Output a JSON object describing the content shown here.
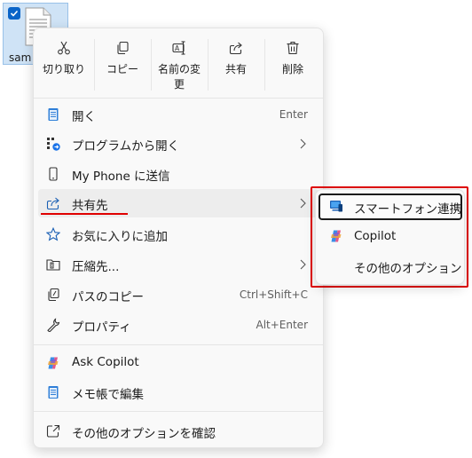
{
  "desktop_file": {
    "name": "sam"
  },
  "toolbar": {
    "cut": "切り取り",
    "copy": "コピー",
    "rename": "名前の変更",
    "share": "共有",
    "delete": "削除"
  },
  "menu": {
    "open": {
      "label": "開く",
      "shortcut": "Enter"
    },
    "open_with": {
      "label": "プログラムから開く"
    },
    "send_to_phone": {
      "label": "My Phone に送信"
    },
    "share_to": {
      "label": "共有先"
    },
    "add_favorite": {
      "label": "お気に入りに追加"
    },
    "compress": {
      "label": "圧縮先..."
    },
    "copy_path": {
      "label": "パスのコピー",
      "shortcut": "Ctrl+Shift+C"
    },
    "properties": {
      "label": "プロパティ",
      "shortcut": "Alt+Enter"
    },
    "ask_copilot": {
      "label": "Ask Copilot"
    },
    "edit_notepad": {
      "label": "メモ帳で編集"
    },
    "more_options": {
      "label": "その他のオプションを確認"
    }
  },
  "submenu": {
    "phone_link": "スマートフォン連携",
    "copilot": "Copilot",
    "other_options": "その他のオプション"
  },
  "colors": {
    "accent": "#0a64c8",
    "highlight": "#e00000",
    "hover": "#ededed"
  }
}
